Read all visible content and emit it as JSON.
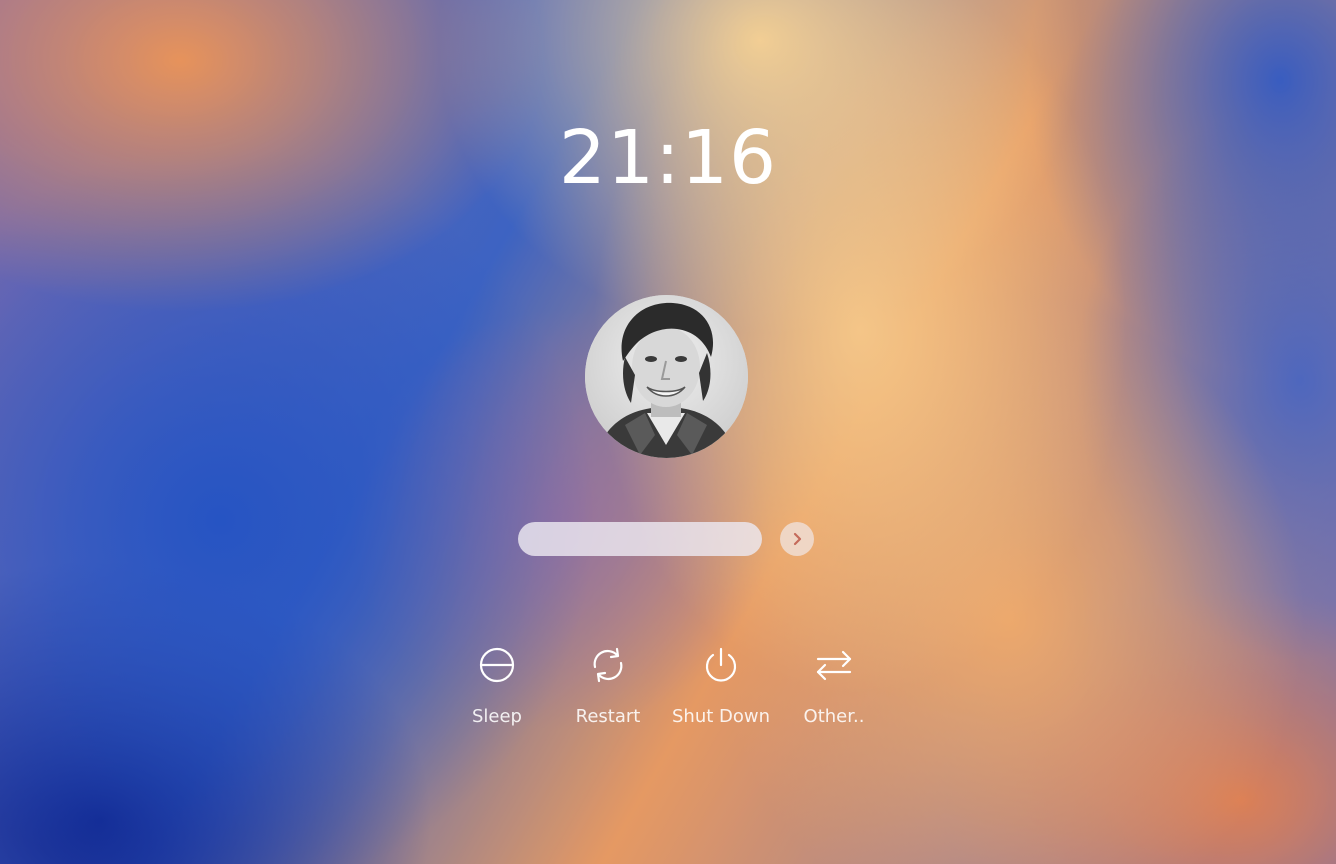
{
  "lock_screen": {
    "clock": "21:16",
    "password": {
      "value": "",
      "placeholder": ""
    },
    "submit_icon": "chevron-right-icon",
    "avatar_icon": "user-photo",
    "actions": [
      {
        "label": "Sleep",
        "icon": "sleep-icon"
      },
      {
        "label": "Restart",
        "icon": "restart-icon"
      },
      {
        "label": "Shut Down",
        "icon": "power-icon"
      },
      {
        "label": "Other..",
        "icon": "switch-user-icon"
      }
    ]
  },
  "colors": {
    "text": "#ffffff",
    "field_bg": "#ebe8f0"
  }
}
